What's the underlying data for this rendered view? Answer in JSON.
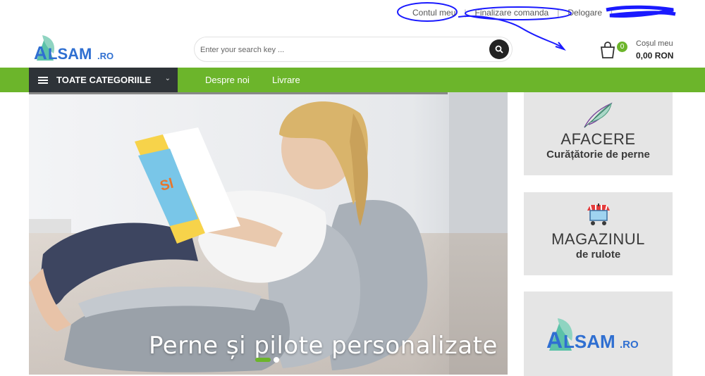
{
  "top_links": [
    "Contul meu",
    "Finalizare comanda",
    "Delogare"
  ],
  "brand": {
    "logo_text": "ALSAM.ro",
    "accent": "#6cb52b",
    "logo_blue": "#2f6fd1",
    "logo_green": "#5bc2a8"
  },
  "search": {
    "placeholder": "Enter your search key ...",
    "icon": "search-icon"
  },
  "cart": {
    "count": "0",
    "label": "Coșul meu",
    "total": "0,00 RON",
    "icon": "shopping-bag-icon"
  },
  "nav": {
    "categories_label": "TOATE CATEGORIILE",
    "links": [
      "Despre noi",
      "Livrare"
    ],
    "bg": "#6cb52b",
    "menu_bg": "#2e3338"
  },
  "hero": {
    "caption": "Perne și pilote personalizate",
    "slides": 2,
    "active_slide": 1
  },
  "banners": [
    {
      "title": "AFACERE",
      "subtitle": "Curățătorie de perne",
      "icon": "feather-icon"
    },
    {
      "title": "MAGAZINUL",
      "subtitle": "de rulote",
      "icon": "shop-stall-icon"
    },
    {
      "title": "ALSAM.ro",
      "subtitle": "",
      "icon": "alsam-logo"
    }
  ]
}
